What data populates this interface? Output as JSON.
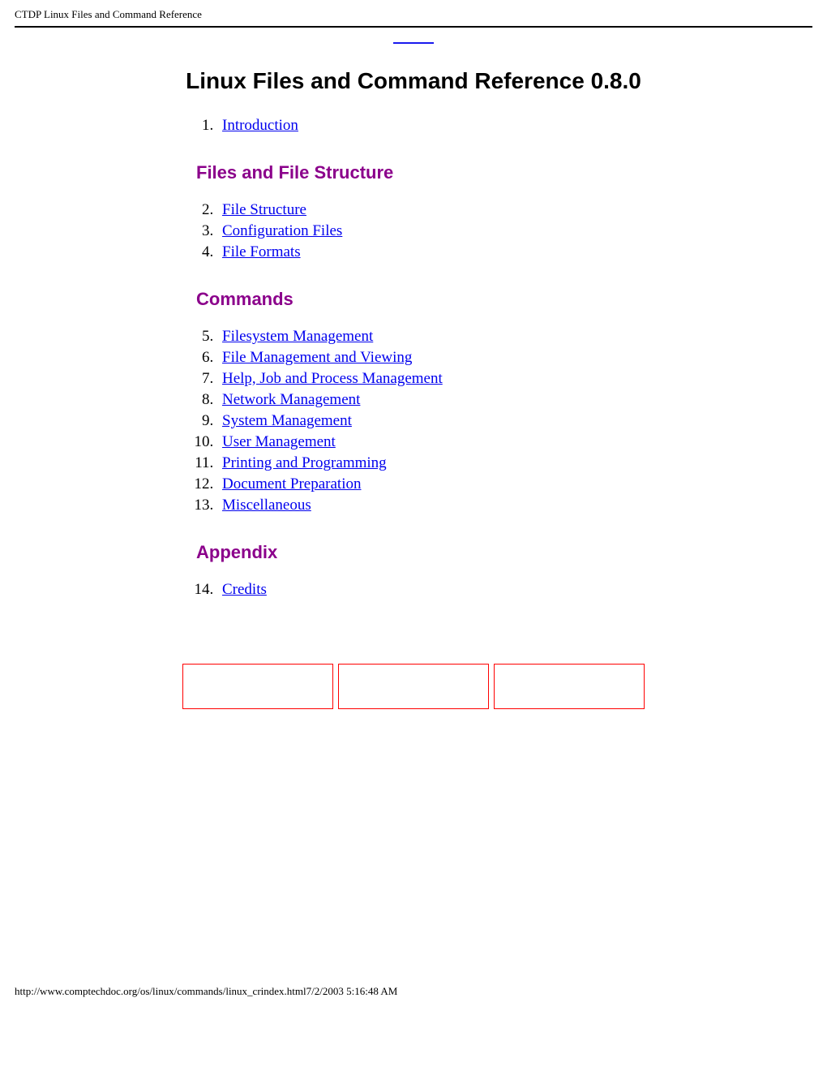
{
  "header": {
    "title": "CTDP Linux Files and Command Reference"
  },
  "page_title": "Linux Files and Command Reference 0.8.0",
  "sections": {
    "files": "Files and File Structure",
    "commands": "Commands",
    "appendix": "Appendix"
  },
  "toc": {
    "intro": "Introduction",
    "file_structure": "File Structure",
    "config_files": "Configuration Files",
    "file_formats": "File Formats",
    "filesystem_mgmt": "Filesystem Management",
    "file_mgmt_view": "File Management and Viewing",
    "help_job_proc": "Help, Job and Process Management",
    "network_mgmt": "Network Management",
    "system_mgmt": "System Management",
    "user_mgmt": "User Management",
    "printing_prog": "Printing and Programming",
    "doc_prep": "Document Preparation",
    "misc": "Miscellaneous",
    "credits": "Credits"
  },
  "footer": {
    "text": "http://www.comptechdoc.org/os/linux/commands/linux_crindex.html7/2/2003 5:16:48 AM"
  }
}
